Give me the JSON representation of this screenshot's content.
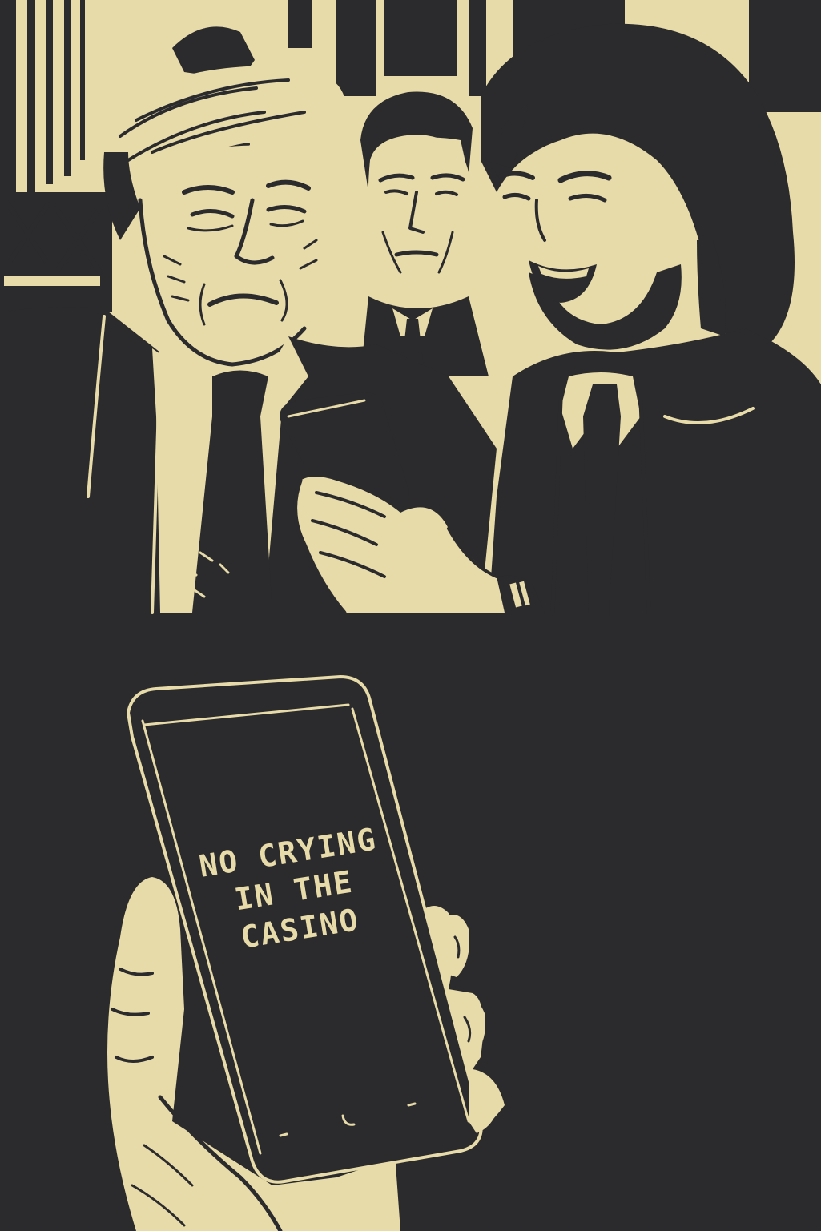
{
  "palette": {
    "ink": "#2b2a2d",
    "cream": "#e7dba9"
  },
  "scene": {
    "upper_panel": "three-men-in-suits-looking-at-phone",
    "lower_panel": "hand-holding-phone"
  },
  "phone_screen": {
    "lines": [
      "NO CRYING",
      "IN THE",
      "CASINO"
    ]
  }
}
